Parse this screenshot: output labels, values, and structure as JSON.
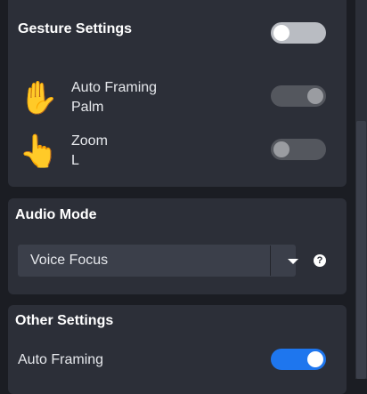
{
  "gesture_settings": {
    "title": "Gesture Settings",
    "enabled": false,
    "gestures": [
      {
        "emoji": "✋",
        "icon": "raised-hand-icon",
        "action": "Auto Framing",
        "gesture": "Palm",
        "enabled": true
      },
      {
        "emoji": "👆",
        "icon": "pointing-finger-icon",
        "action": "Zoom",
        "gesture": "L",
        "enabled": false
      }
    ]
  },
  "audio_mode": {
    "title": "Audio Mode",
    "selected": "Voice Focus",
    "help_glyph": "?"
  },
  "other_settings": {
    "title": "Other Settings",
    "auto_framing_label": "Auto Framing",
    "auto_framing_enabled": true
  },
  "colors": {
    "accent": "#1e76ee",
    "panel": "#2c2f38",
    "background": "#1b1d23"
  }
}
